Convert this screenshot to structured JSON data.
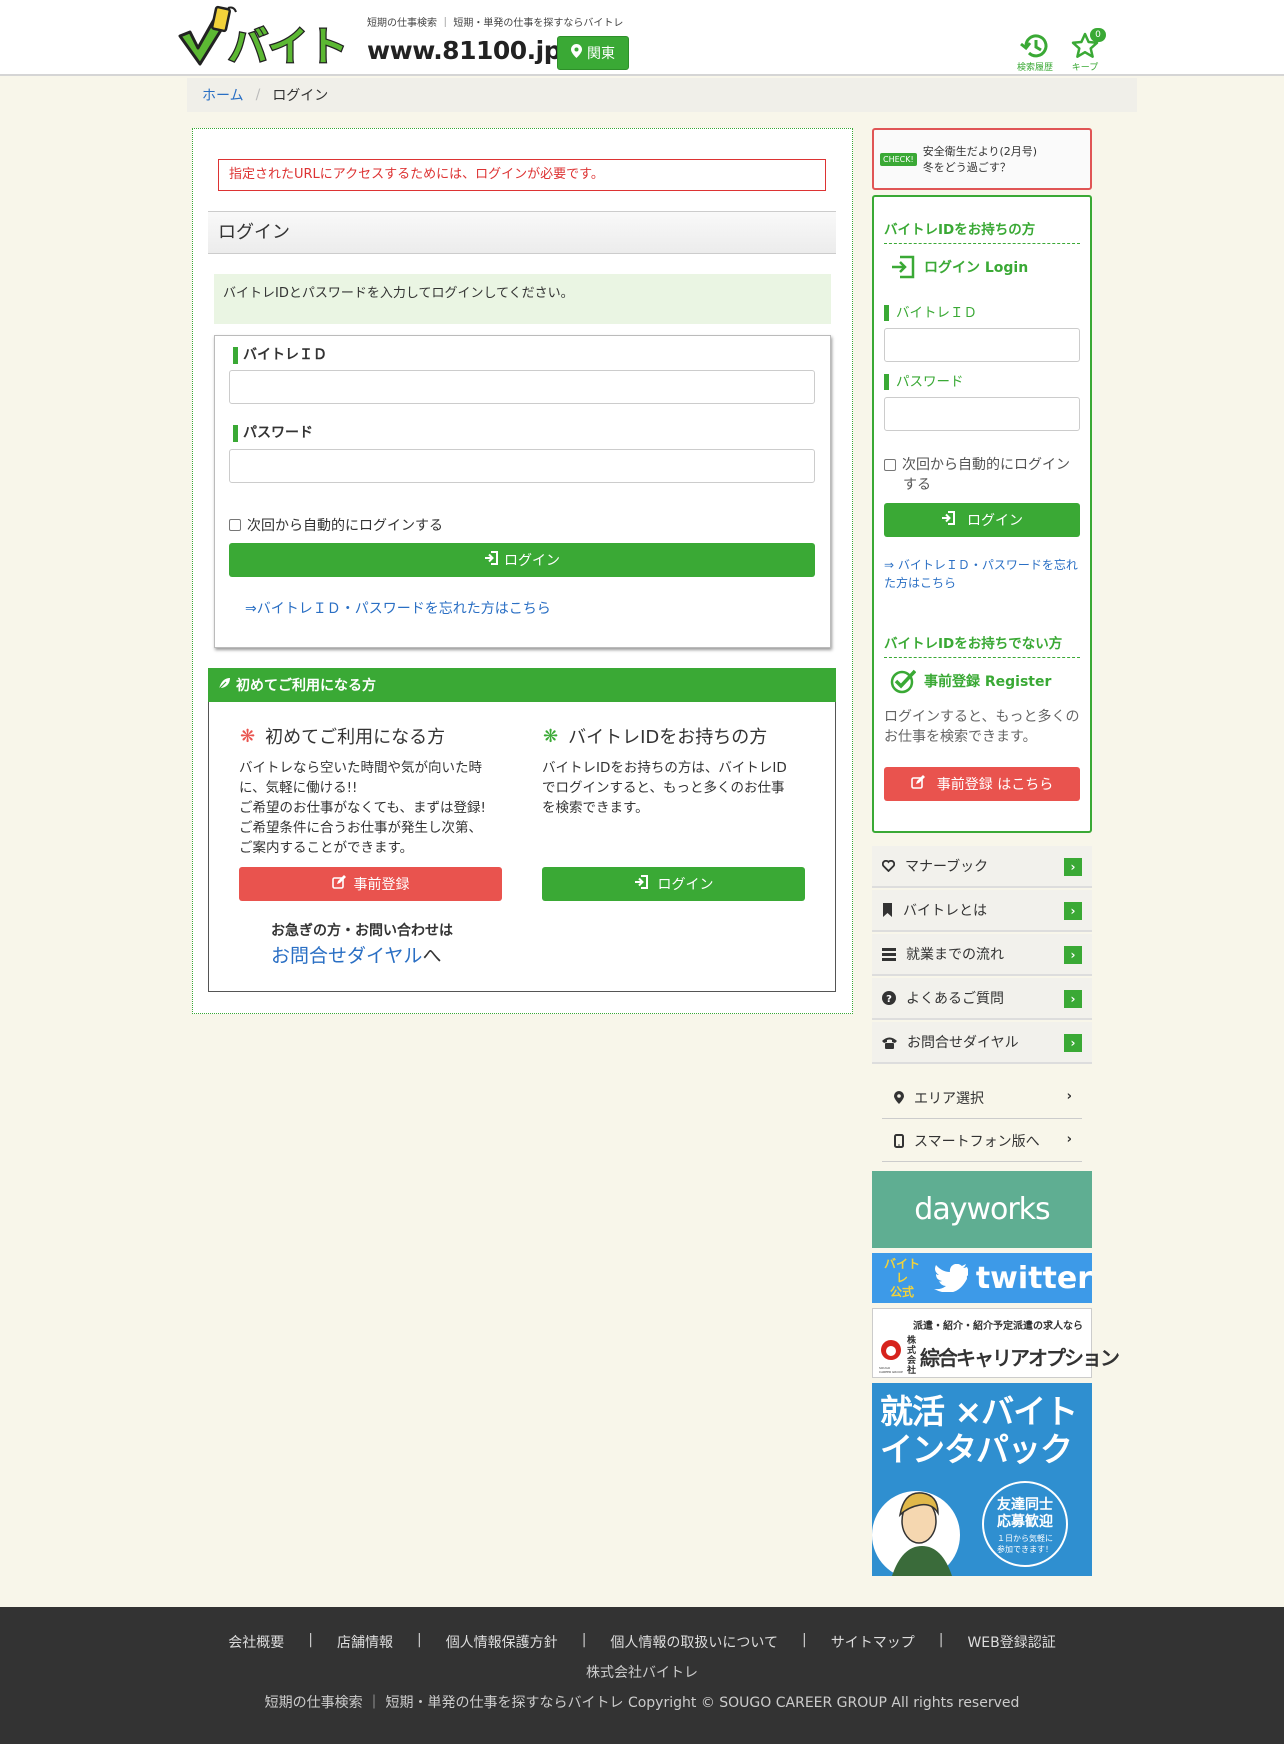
{
  "header": {
    "logo_text": "バイトレ",
    "tagline": "短期の仕事検索 ｜ 短期・単発の仕事を探すならバイトレ",
    "url": "www.81100.jp",
    "region_button": "関東",
    "history_label": "検索履歴",
    "keep_label": "キープ",
    "keep_count": "0"
  },
  "breadcrumb": {
    "home": "ホーム",
    "separator": "/",
    "current": "ログイン"
  },
  "main": {
    "alert": "指定されたURLにアクセスするためには、ログインが必要です。",
    "title": "ログイン",
    "info": "バイトレIDとパスワードを入力してログインしてください。",
    "form": {
      "id_label": "バイトレＩＤ",
      "id_value": "",
      "password_label": "パスワード",
      "password_value": "",
      "remember_label": "次回から自動的にログインする",
      "login_button": "ログイン",
      "forgot_link": "⇒バイトレＩＤ・パスワードを忘れた方はこちら"
    },
    "first_time": {
      "header": "初めてご利用になる方",
      "left": {
        "title": "初めてご利用になる方",
        "text_lines": [
          "バイトレなら空いた時間や気が向いた時",
          "に、気軽に働ける!!",
          "ご希望のお仕事がなくても、まずは登録!",
          "ご希望条件に合うお仕事が発生し次第、",
          "ご案内することができます。"
        ],
        "button": "事前登録"
      },
      "right": {
        "title": "バイトレIDをお持ちの方",
        "text_lines": [
          "バイトレIDをお持ちの方は、バイトレID",
          "でログインすると、もっと多くのお仕事",
          "を検索できます。"
        ],
        "button": "ログイン"
      },
      "contact_line": "お急ぎの方・お問い合わせは",
      "contact_link": "お問合せダイヤル",
      "contact_suffix": "へ"
    }
  },
  "sidebar": {
    "notice_badge": "CHECK!",
    "notice_line1": "安全衛生だより(2月号)",
    "notice_line2": "冬をどう過ごす？",
    "has_id_heading": "バイトレIDをお持ちの方",
    "login_title": "ログイン Login",
    "id_label": "バイトレＩＤ",
    "password_label": "パスワード",
    "remember_line1": "次回から自動的にログイン",
    "remember_line2": "する",
    "login_button": "ログイン",
    "forgot_line1": "⇒ バイトレＩＤ・パスワードを忘れ",
    "forgot_line2": "た方はこちら",
    "no_id_heading": "バイトレIDをお持ちでない方",
    "register_title": "事前登録 Register",
    "register_text_line1": "ログインすると、もっと多くの",
    "register_text_line2": "お仕事を検索できます。",
    "register_button": "事前登録 はこちら",
    "menu": [
      "マナーブック",
      "バイトレとは",
      "就業までの流れ",
      "よくあるご質問",
      "お問合せダイヤル"
    ],
    "sub_menu": [
      "エリア選択",
      "スマートフォン版へ"
    ],
    "banners": {
      "dayworks": "dayworks",
      "twitter_badge_line1": "バイトレ",
      "twitter_badge_line2": "公式",
      "twitter": "twitter",
      "career_line1": "派遣・紹介・紹介予定派遣の求人なら",
      "career_company_prefix": "株式会社",
      "career_name": "綜合キャリアオプション",
      "career_logo_caption": "SOUGO CAREER GROUP",
      "intern_line1": "就活 ×バイト",
      "intern_line2": "インタパック",
      "intern_badge_line1": "友達同士",
      "intern_badge_line2": "応募歓迎",
      "intern_badge_line3": "１日から気軽に",
      "intern_badge_line4": "参加できます！"
    }
  },
  "footer": {
    "links": [
      "会社概要",
      "店舗情報",
      "個人情報保護方針",
      "個人情報の取扱いについて",
      "サイトマップ",
      "WEB登録認証"
    ],
    "company": "株式会社バイトレ",
    "copyright": "短期の仕事検索 ｜ 短期・単発の仕事を探すならバイトレ Copyright © SOUGO CAREER GROUP All rights reserved"
  },
  "colors": {
    "accent": "#3aa935",
    "alert": "#dd3333",
    "register": "#e9534e",
    "background": "#f8f6ea",
    "footer": "#333333",
    "dayworks": "#5fae92",
    "twitter": "#3d9ae8",
    "intern": "#2f8fd0"
  }
}
